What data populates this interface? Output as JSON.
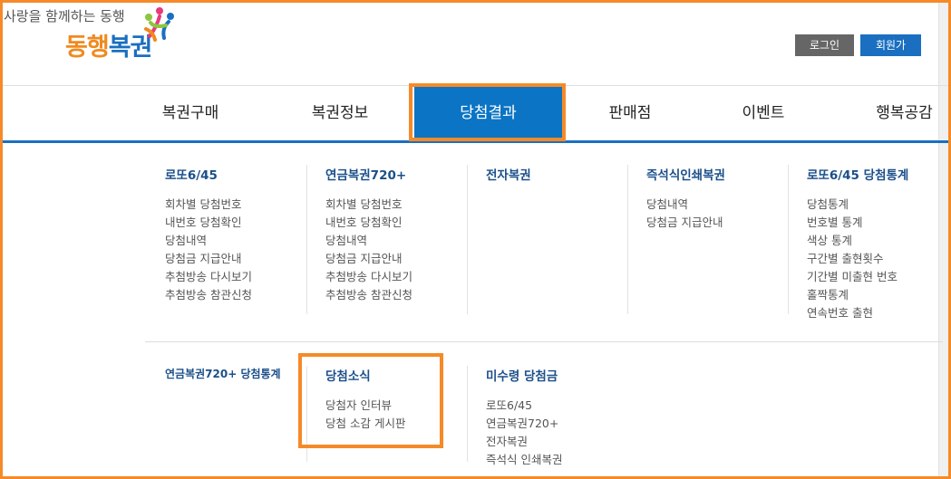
{
  "header": {
    "tagline": "사랑을 함께하는 동행",
    "logo_orange": "동행",
    "logo_blue": "복권",
    "login_label": "로그인",
    "join_label": "회원가입"
  },
  "nav": {
    "items": [
      {
        "label": "복권구매"
      },
      {
        "label": "복권정보"
      },
      {
        "label": "당첨결과"
      },
      {
        "label": "판매점"
      },
      {
        "label": "이벤트"
      },
      {
        "label": "행복공감"
      }
    ],
    "active_index": 2
  },
  "menu": {
    "row1": [
      {
        "title": "로또6/45",
        "items": [
          "회차별 당첨번호",
          "내번호 당첨확인",
          "당첨내역",
          "당첨금 지급안내",
          "추첨방송 다시보기",
          "추첨방송 참관신청"
        ]
      },
      {
        "title": "연금복권720+",
        "items": [
          "회차별 당첨번호",
          "내번호 당첨확인",
          "당첨내역",
          "당첨금 지급안내",
          "추첨방송 다시보기",
          "추첨방송 참관신청"
        ]
      },
      {
        "title": "전자복권",
        "items": []
      },
      {
        "title": "즉석식인쇄복권",
        "items": [
          "당첨내역",
          "당첨금 지급안내"
        ]
      },
      {
        "title": "로또6/45 당첨통계",
        "items": [
          "당첨통계",
          "번호별 통계",
          "색상 통계",
          "구간별 출현횟수",
          "기간별 미출현 번호",
          "홀짝통계",
          "연속번호 출현"
        ]
      }
    ],
    "row2": [
      {
        "title": "연금복권720+ 당첨통계",
        "items": []
      },
      {
        "title": "당첨소식",
        "items": [
          "당첨자 인터뷰",
          "당첨 소감 게시판"
        ]
      },
      {
        "title": "미수령 당첨금",
        "items": [
          "로또6/45",
          "연금복권720+",
          "전자복권",
          "즉석식 인쇄복권"
        ]
      }
    ]
  },
  "colors": {
    "brand_blue": "#1a6fc0",
    "brand_orange": "#f08a1e",
    "highlight": "#f58a28"
  }
}
